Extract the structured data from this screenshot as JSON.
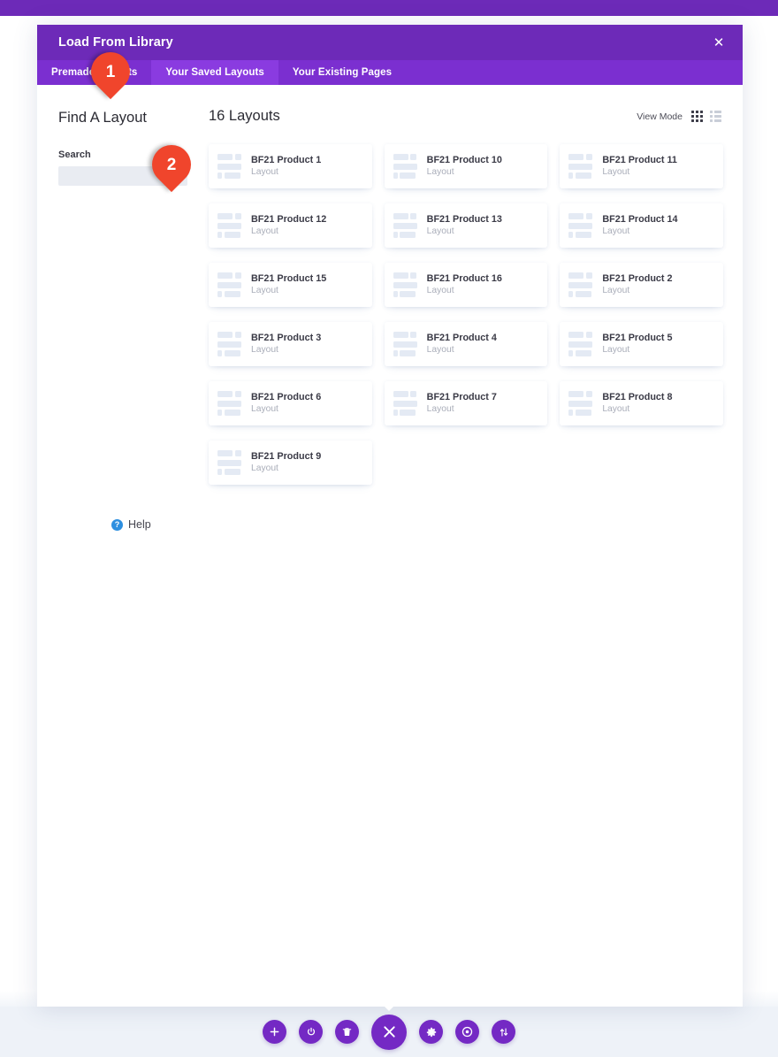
{
  "modal": {
    "title": "Load From Library",
    "close_label": "✕",
    "tabs": [
      {
        "label": "Premade Layouts",
        "active": false
      },
      {
        "label": "Your Saved Layouts",
        "active": true
      },
      {
        "label": "Your Existing Pages",
        "active": false
      }
    ]
  },
  "sidebar": {
    "title": "Find A Layout",
    "search_label": "Search",
    "search_value": "",
    "search_placeholder": "",
    "help_label": "Help",
    "help_icon_glyph": "?"
  },
  "main": {
    "count_title": "16 Layouts",
    "view_mode_label": "View Mode",
    "view_modes": [
      {
        "name": "grid-view",
        "active": true
      },
      {
        "name": "list-view",
        "active": false
      }
    ],
    "cards": [
      {
        "title": "BF21 Product 1",
        "subtitle": "Layout"
      },
      {
        "title": "BF21 Product 10",
        "subtitle": "Layout"
      },
      {
        "title": "BF21 Product 11",
        "subtitle": "Layout"
      },
      {
        "title": "BF21 Product 12",
        "subtitle": "Layout"
      },
      {
        "title": "BF21 Product 13",
        "subtitle": "Layout"
      },
      {
        "title": "BF21 Product 14",
        "subtitle": "Layout"
      },
      {
        "title": "BF21 Product 15",
        "subtitle": "Layout"
      },
      {
        "title": "BF21 Product 16",
        "subtitle": "Layout"
      },
      {
        "title": "BF21 Product 2",
        "subtitle": "Layout"
      },
      {
        "title": "BF21 Product 3",
        "subtitle": "Layout"
      },
      {
        "title": "BF21 Product 4",
        "subtitle": "Layout"
      },
      {
        "title": "BF21 Product 5",
        "subtitle": "Layout"
      },
      {
        "title": "BF21 Product 6",
        "subtitle": "Layout"
      },
      {
        "title": "BF21 Product 7",
        "subtitle": "Layout"
      },
      {
        "title": "BF21 Product 8",
        "subtitle": "Layout"
      },
      {
        "title": "BF21 Product 9",
        "subtitle": "Layout"
      }
    ]
  },
  "markers": [
    {
      "number": "1"
    },
    {
      "number": "2"
    }
  ],
  "bottom_bar": {
    "buttons": [
      {
        "name": "add-button",
        "icon": "plus-icon"
      },
      {
        "name": "power-button",
        "icon": "power-icon"
      },
      {
        "name": "trash-button",
        "icon": "trash-icon"
      },
      {
        "name": "close-button",
        "icon": "close-icon"
      },
      {
        "name": "settings-button",
        "icon": "gear-icon"
      },
      {
        "name": "history-button",
        "icon": "clock-icon"
      },
      {
        "name": "reorder-button",
        "icon": "sort-arrows-icon"
      }
    ]
  },
  "colors": {
    "header_purple": "#6d2ab8",
    "tabbar_purple": "#7b2fd0",
    "tab_active_purple": "#8a3be0",
    "marker_red": "#f0452c",
    "button_purple": "#7429c4",
    "help_blue": "#2d8fe0",
    "thumb_block": "#e4eaf4",
    "page_backdrop": "#eef2f8"
  }
}
